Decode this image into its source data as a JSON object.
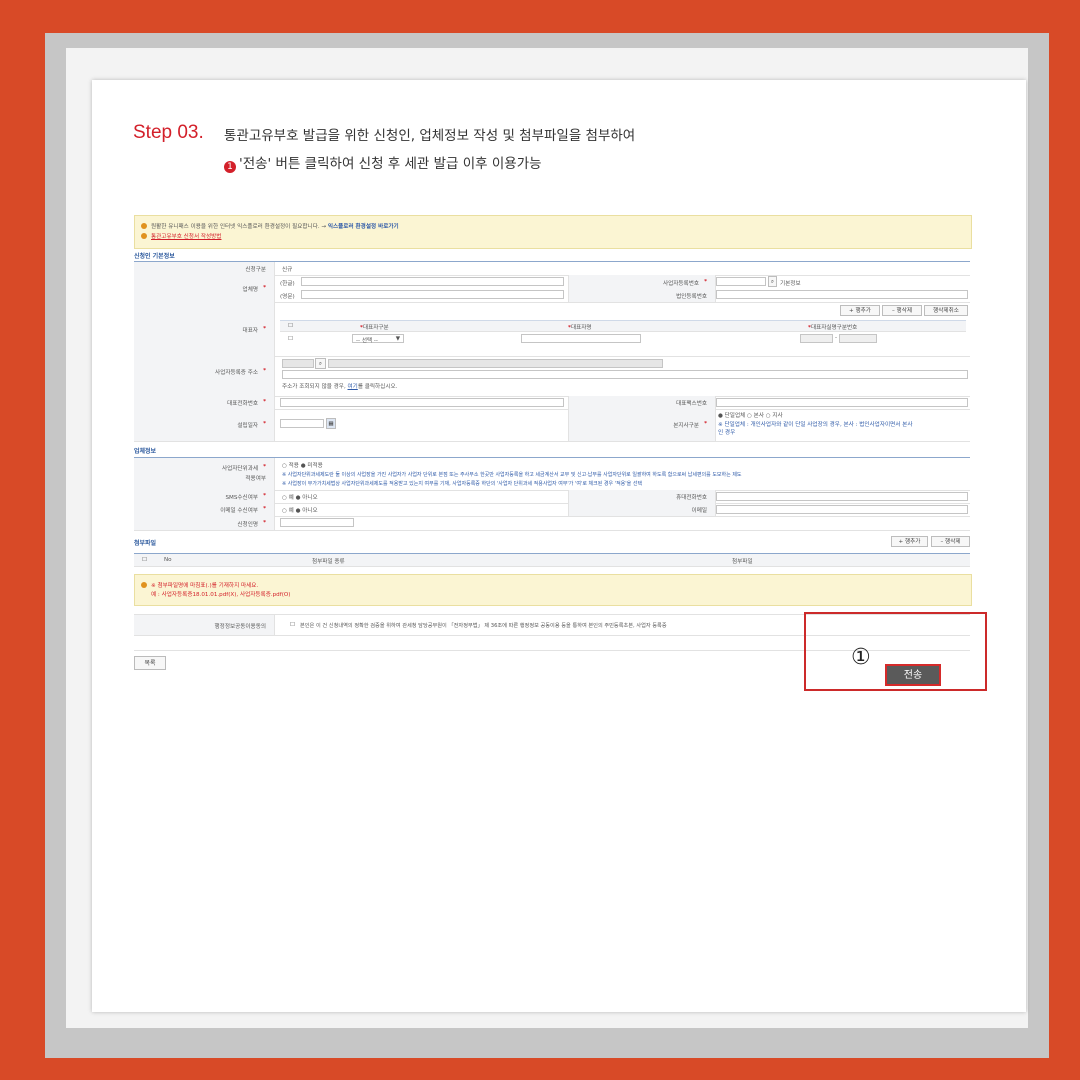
{
  "header": {
    "step": "Step 03.",
    "desc_line1": "통관고유부호 발급을 위한 신청인, 업체정보 작성 및 첨부파일을 첨부하여",
    "desc_line2_marker": "❶",
    "desc_line2": "'전송' 버튼 클릭하여 신청 후 세관 발급 이후 이용가능"
  },
  "notice_top": {
    "line1": "원활한 유니패스 이용을 위한 인터넷 익스플로러 환경설정이 필요합니다. →",
    "line1_link": "익스플로러 환경설정 바로가기",
    "line2": "통관고유부호 신청서 작성방법"
  },
  "applicant": {
    "section_title": "신청인 기본정보",
    "apply_type_label": "신청구분",
    "apply_type_value": "신규",
    "company_name_label": "업체명",
    "korean_tag": "(한글)",
    "english_tag": "(영문)",
    "biz_reg_no_label": "사업자등록번호",
    "basic_info_label": "기본정보",
    "corp_reg_no_label": "법인등록번호",
    "add_row_btn": "+ 행추가",
    "del_row_btn": "– 행삭제",
    "reset_btn": "행삭제취소",
    "ceo_label": "대표자",
    "ceo_type_col": "대표자구분",
    "ceo_name_col": "대표자명",
    "ceo_id_col": "대표자실명구분번호",
    "select_placeholder": "-- 선택 --",
    "address_label": "사업자등록증 주소",
    "address_hint_prefix": "주소가 조회되지 않을 경우,",
    "address_hint_link": "여기",
    "address_hint_suffix": "를 클릭하십시오.",
    "phone_label": "대표전화번호",
    "fax_label": "대표팩스번호",
    "est_date_label": "설립일자",
    "hq_label": "본지사구분",
    "hq_options": "● 단일업체  ○ 본사  ○ 지사",
    "hq_note1": "※ 단일업체 : 개인사업자와 같이 단일 사업장의 경우, 본사 : 법인사업자이면서 본사",
    "hq_note2": "인 경우"
  },
  "company": {
    "section_title": "업체정보",
    "tax_unit_label1": "사업자단위과세",
    "tax_unit_label2": "적용여부",
    "tax_unit_options": "○ 적용  ● 미적용",
    "tax_unit_note1": "※ 사업자단위과세제도란 둘 이상의 사업장을 가진 사업자가 사업자 단위로 본점 또는 주사무소 한곳만 사업자등록을 하고 세금계산서 교부 및 신고·납부를 사업자단위로 일괄하여 하도록 함으로써 납세편의를 도모하는 제도",
    "tax_unit_note2": "※ 사업장이 부가가치세법상 사업자단위과세제도를 적용받고 있는지 여부를 기재, 사업자등록증 하단의 '사업자 단위과세 적용사업자 여부'가 '여'로 체크된 경우 '적용'을 선택",
    "sms_label": "SMS수신여부",
    "sms_options": "○ 예  ● 아니오",
    "mobile_label": "휴대전화번호",
    "email_recv_label": "이메일 수신여부",
    "email_options": "○ 예  ● 아니오",
    "email_label": "이메일",
    "applicant_name_label": "신청인명"
  },
  "attachments": {
    "section_title": "첨부파일",
    "add_btn": "+ 행추가",
    "del_btn": "– 행삭제",
    "no_col": "No",
    "type_col": "첨부파일 종류",
    "file_col": "첨부파일",
    "note1": "※ 첨부파일명에 마침표(.)를 기재하지 마세요.",
    "note2": "예 : 사업자등록증18.01.01.pdf(X), 사업자등록증.pdf(O)"
  },
  "consent": {
    "label": "행정정보공동이용동의",
    "text": "본인은 이 건 신청내역의 정확한 검증을 위하여 관세청 담당공무원이 「전자정부법」 제 36조에 따른 행정정보 공동이용 등을 통하여 본인의 주민등록초본, 사업자 등록증"
  },
  "buttons": {
    "list": "목록",
    "send": "전송",
    "marker": "①"
  }
}
